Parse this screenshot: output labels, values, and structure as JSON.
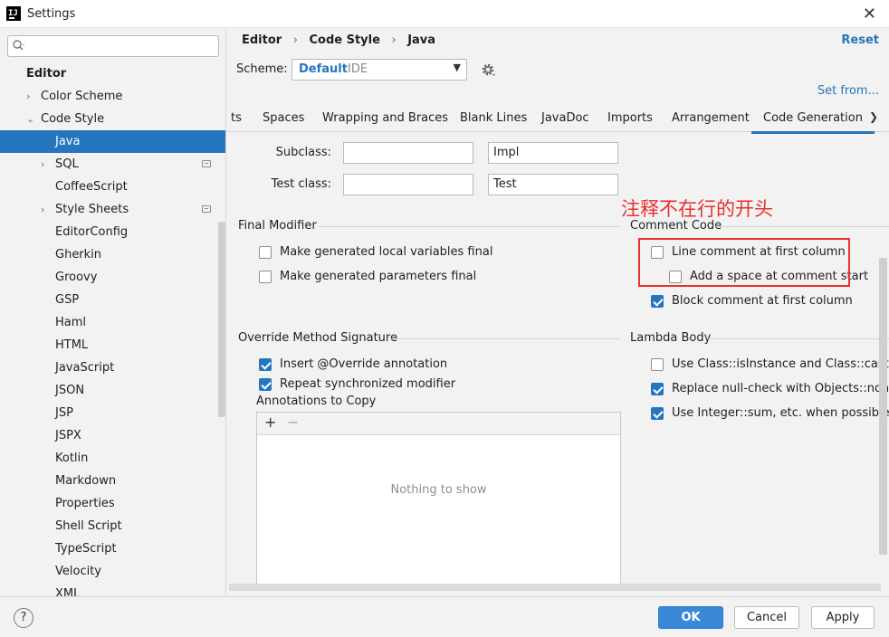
{
  "window": {
    "title": "Settings"
  },
  "search": {
    "placeholder": ""
  },
  "sidebar": {
    "heading": "Editor",
    "items": [
      {
        "label": "Color Scheme",
        "arrow": "›",
        "indent": 1
      },
      {
        "label": "Code Style",
        "arrow": "⌄",
        "indent": 1
      },
      {
        "label": "Java",
        "indent": 2,
        "selected": true
      },
      {
        "label": "SQL",
        "arrow": "›",
        "indent": 2,
        "badge": true
      },
      {
        "label": "CoffeeScript",
        "indent": 2
      },
      {
        "label": "Style Sheets",
        "arrow": "›",
        "indent": 2,
        "badge": true
      },
      {
        "label": "EditorConfig",
        "indent": 2
      },
      {
        "label": "Gherkin",
        "indent": 2
      },
      {
        "label": "Groovy",
        "indent": 2
      },
      {
        "label": "GSP",
        "indent": 2
      },
      {
        "label": "Haml",
        "indent": 2
      },
      {
        "label": "HTML",
        "indent": 2
      },
      {
        "label": "JavaScript",
        "indent": 2
      },
      {
        "label": "JSON",
        "indent": 2
      },
      {
        "label": "JSP",
        "indent": 2
      },
      {
        "label": "JSPX",
        "indent": 2
      },
      {
        "label": "Kotlin",
        "indent": 2
      },
      {
        "label": "Markdown",
        "indent": 2
      },
      {
        "label": "Properties",
        "indent": 2
      },
      {
        "label": "Shell Script",
        "indent": 2
      },
      {
        "label": "TypeScript",
        "indent": 2
      },
      {
        "label": "Velocity",
        "indent": 2
      },
      {
        "label": "XML",
        "indent": 2
      }
    ]
  },
  "breadcrumb": {
    "a": "Editor",
    "b": "Code Style",
    "c": "Java",
    "sep": "›"
  },
  "reset_label": "Reset",
  "scheme": {
    "label": "Scheme:",
    "name": "Default",
    "type": "IDE"
  },
  "set_from": "Set from...",
  "tabs": [
    {
      "label": "ts"
    },
    {
      "label": "Spaces"
    },
    {
      "label": "Wrapping and Braces"
    },
    {
      "label": "Blank Lines"
    },
    {
      "label": "JavaDoc"
    },
    {
      "label": "Imports"
    },
    {
      "label": "Arrangement"
    },
    {
      "label": "Code Generation",
      "active": true
    }
  ],
  "fields": {
    "subclass_label": "Subclass:",
    "subclass_prefix": "",
    "subclass_suffix": "Impl",
    "test_label": "Test class:",
    "test_prefix": "",
    "test_suffix": "Test"
  },
  "final_modifier": {
    "title": "Final Modifier",
    "local_vars": {
      "label": "Make generated local variables final",
      "checked": false
    },
    "params": {
      "label": "Make generated parameters final",
      "checked": false
    }
  },
  "comment_code": {
    "title": "Comment Code",
    "line_first": {
      "label": "Line comment at first column",
      "checked": false
    },
    "add_space": {
      "label": "Add a space at comment start",
      "checked": false
    },
    "block_first": {
      "label": "Block comment at first column",
      "checked": true
    }
  },
  "override": {
    "title": "Override Method Signature",
    "insert": {
      "label": "Insert @Override annotation",
      "checked": true
    },
    "repeat": {
      "label": "Repeat synchronized modifier",
      "checked": true
    },
    "annotations_label": "Annotations to Copy",
    "empty_text": "Nothing to show"
  },
  "lambda": {
    "title": "Lambda Body",
    "isinstance": {
      "label": "Use Class::isInstance and Class::cast when",
      "checked": false
    },
    "nullcheck": {
      "label": "Replace null-check with Objects::nonNull o",
      "checked": true
    },
    "integer_sum": {
      "label": "Use Integer::sum, etc. when possible",
      "checked": true
    }
  },
  "annotation_note": "注释不在行的开头",
  "footer": {
    "help": "?",
    "ok": "OK",
    "cancel": "Cancel",
    "apply": "Apply"
  },
  "colors": {
    "accent": "#2675bf",
    "annotation_red": "#e8302d",
    "primary_button": "#3a88d8"
  }
}
